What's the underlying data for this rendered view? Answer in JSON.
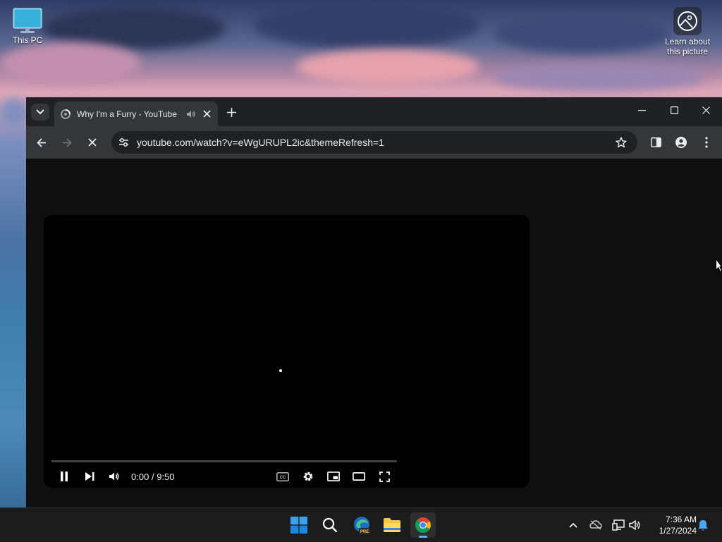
{
  "desktop": {
    "icons": [
      {
        "label": "This PC",
        "icon": "monitor-icon"
      },
      {
        "label": "Learn about this picture",
        "icon": "learn-picture-icon"
      }
    ]
  },
  "browser": {
    "tab": {
      "title": "Why I'm a Furry - YouTube",
      "audio_icon": "speaker-icon",
      "close_icon": "close-icon"
    },
    "url": "youtube.com/watch?v=eWgURUPL2ic&themeRefresh=1",
    "window_controls": [
      "minimize",
      "maximize",
      "close"
    ]
  },
  "player": {
    "current_time": "0:00",
    "separator": "/",
    "duration": "9:50",
    "progress_fraction": 0,
    "accent_color": "#ff0000"
  },
  "taskbar": {
    "apps": [
      "start",
      "search",
      "edge-preview",
      "file-explorer",
      "chrome"
    ],
    "active_app": "chrome",
    "edge_badge": "PRE",
    "clock": {
      "time": "7:36 AM",
      "date": "1/27/2024"
    }
  }
}
